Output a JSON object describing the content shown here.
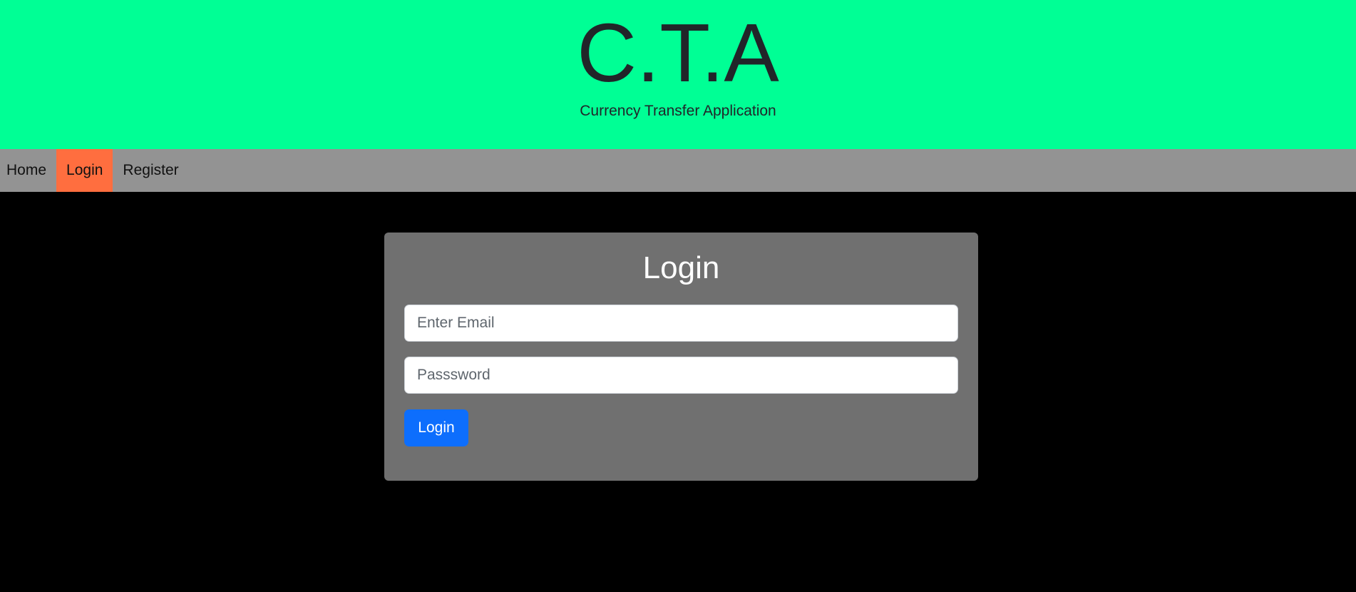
{
  "header": {
    "title": "C.T.A",
    "subtitle": "Currency Transfer Application"
  },
  "nav": {
    "items": [
      {
        "label": "Home",
        "active": false
      },
      {
        "label": "Login",
        "active": true
      },
      {
        "label": "Register",
        "active": false
      }
    ]
  },
  "login_form": {
    "title": "Login",
    "email": {
      "value": "",
      "placeholder": "Enter Email"
    },
    "password": {
      "value": "",
      "placeholder": "Passsword"
    },
    "submit_label": "Login"
  },
  "colors": {
    "header_bg": "#00ff95",
    "nav_bg": "#939393",
    "nav_active": "#ff6e3f",
    "page_bg": "#000000",
    "card_bg": "#707070",
    "button_bg": "#0d6efd"
  }
}
